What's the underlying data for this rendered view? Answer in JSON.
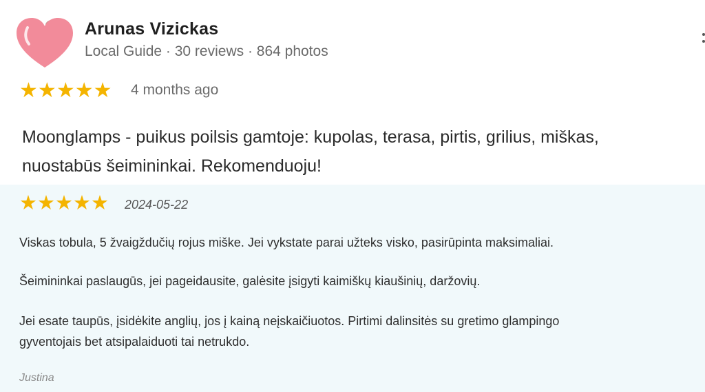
{
  "reviewer": {
    "name": "Arunas Vizickas",
    "meta": "Local Guide · 30 reviews · 864 photos",
    "rating": 5,
    "time_ago": "4 months ago",
    "text_line1": "Moonglamps - puikus poilsis gamtoje: kupolas, terasa, pirtis, grilius, miškas,",
    "text_line2": "nuostabūs šeimininkai. Rekomenduoju!"
  },
  "testimonial": {
    "rating": 5,
    "date": "2024-05-22",
    "paragraph1": "Viskas tobula, 5 žvaigždučių rojus miške. Jei vykstate parai užteks visko, pasirūpinta maksimaliai.",
    "paragraph2": "Šeimininkai paslaugūs, jei pageidausite, galėsite įsigyti kaimiškų kiaušinių, daržovių.",
    "paragraph3_line1": "Jei esate taupūs, įsidėkite anglių, jos į kainą neįskaičiuotos. Pirtimi dalinsitės su gretimo glampingo",
    "paragraph3_line2": "gyventojais bet atsipalaiduoti tai netrukdo.",
    "author": "Justina"
  },
  "icons": {
    "avatar": "heart-avatar-icon",
    "star": "star-icon",
    "more": "more-vert-icon"
  },
  "colors": {
    "star": "#f4b400",
    "avatar": "#f28b9a",
    "panel_background": "#f1f9fb"
  }
}
